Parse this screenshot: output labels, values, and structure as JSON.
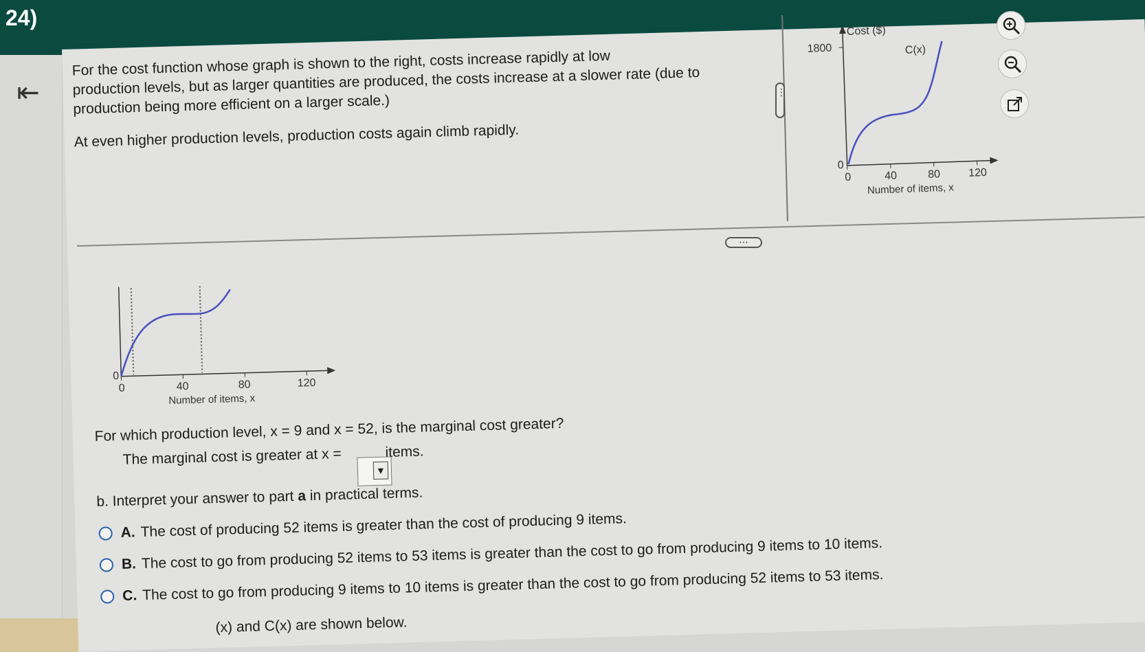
{
  "question": {
    "number": "24)"
  },
  "problem": {
    "line1": "For the cost function whose graph is shown to the right, costs increase rapidly at low",
    "line2": "production levels, but as larger quantities are produced, the costs increase at a slower rate (due to",
    "line3": "production being more efficient on a larger scale.)",
    "line4": "At even higher production levels, production costs again climb rapidly."
  },
  "top_graph": {
    "y_label": "Cost ($)",
    "y_max_label": "1800",
    "y_zero_label": "0",
    "curve_label": "C(x)",
    "x_ticks": [
      "0",
      "40",
      "80",
      "120"
    ],
    "x_label": "Number of items, x"
  },
  "lower_graph": {
    "y_zero_label": "0",
    "x_ticks": [
      "0",
      "40",
      "80",
      "120"
    ],
    "x_label": "Number of items, x"
  },
  "part_a": {
    "prompt": "For which production level, x = 9 and x = 52, is the marginal cost greater?",
    "answer_prefix": "The marginal cost is greater at x =",
    "answer_suffix": "items.",
    "dropdown_value": ""
  },
  "part_b": {
    "prompt_pre": "b. Interpret your answer to part ",
    "prompt_bold": "a",
    "prompt_post": " in practical terms.",
    "options": [
      {
        "label": "A.",
        "text": "The cost of producing 52 items is greater than the cost of producing 9 items."
      },
      {
        "label": "B.",
        "text": "The cost to go from producing 52 items to 53 items is greater than the cost to go from producing 9 items to 10 items."
      },
      {
        "label": "C.",
        "text": "The cost to go from producing 9 items to 10 items is greater than the cost to go from producing 52 items to 53 items."
      }
    ]
  },
  "footer": {
    "text": "(x) and C(x) are shown below."
  },
  "tools": [
    "zoom-in-icon",
    "zoom-out-icon",
    "external-link-icon"
  ],
  "colors": {
    "header": "#0a4a3f",
    "curve": "#4a4fbf",
    "radio": "#2a63a8"
  }
}
